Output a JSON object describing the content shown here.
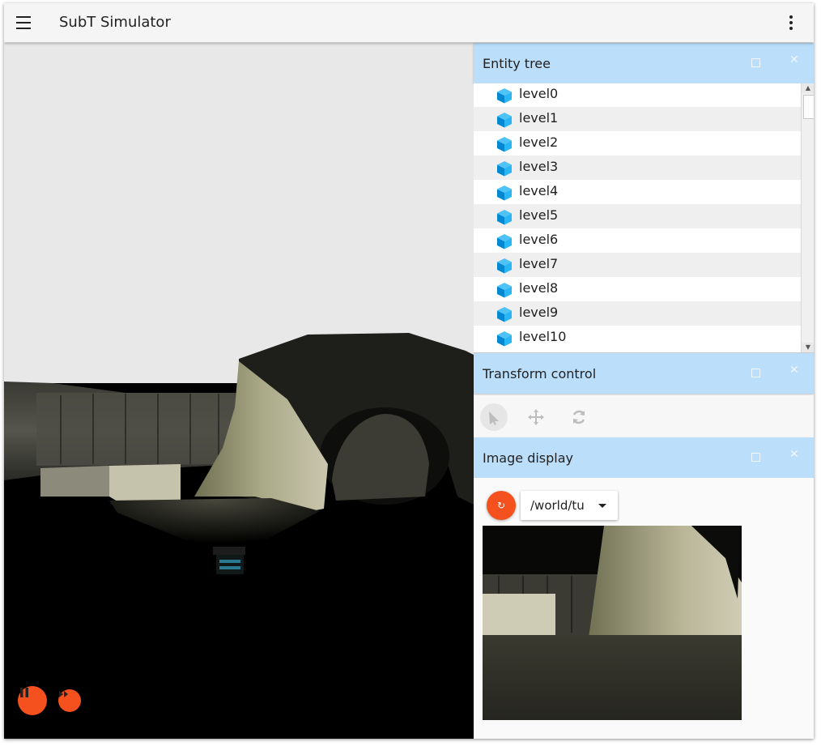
{
  "app": {
    "title": "SubT Simulator",
    "menu_icon": "hamburger-menu-icon",
    "more_icon": "more-vert-icon"
  },
  "scene": {
    "controls": {
      "pause_icon": "pause-icon",
      "step_icon": "fast-forward-icon"
    }
  },
  "entity_tree": {
    "title": "Entity tree",
    "item_icon": "model-cube-icon",
    "items": [
      "level0",
      "level1",
      "level2",
      "level3",
      "level4",
      "level5",
      "level6",
      "level7",
      "level8",
      "level9",
      "level10"
    ]
  },
  "transform_control": {
    "title": "Transform control",
    "tools": [
      "select-arrow-icon",
      "translate-move-icon",
      "rotate-icon"
    ]
  },
  "image_display": {
    "title": "Image display",
    "refresh_label": "↻",
    "topic": "/world/tu"
  },
  "colors": {
    "accent": "#f5511e",
    "panel_header": "#bbdefb",
    "app_bar": "#f5f5f5"
  }
}
